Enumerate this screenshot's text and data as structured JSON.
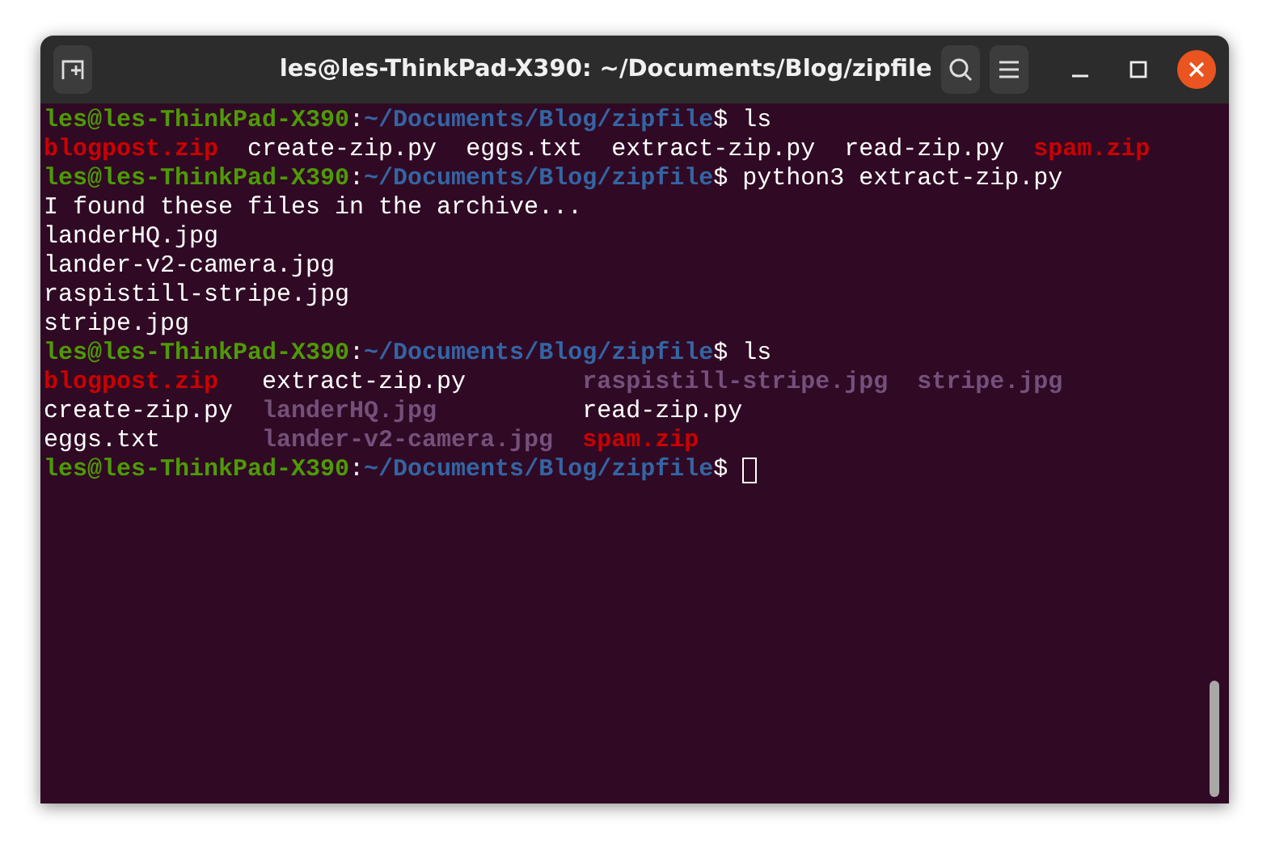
{
  "window": {
    "title": "les@les-ThinkPad-X390: ~/Documents/Blog/zipfile"
  },
  "terminal": {
    "lines": [
      {
        "kind": "prompt",
        "user": "les@les-ThinkPad-X390",
        "sep": ":",
        "path": "~/Documents/Blog/zipfile",
        "sign": "$",
        "command": "ls"
      },
      {
        "kind": "files",
        "rows": [
          [
            {
              "name": "blogpost.zip",
              "color": "#cc0000"
            },
            {
              "name": "create-zip.py",
              "color": "#ffffff"
            },
            {
              "name": "eggs.txt",
              "color": "#ffffff"
            },
            {
              "name": "extract-zip.py",
              "color": "#ffffff"
            },
            {
              "name": "read-zip.py",
              "color": "#ffffff"
            },
            {
              "name": "spam.zip",
              "color": "#cc0000"
            }
          ]
        ]
      },
      {
        "kind": "prompt",
        "user": "les@les-ThinkPad-X390",
        "sep": ":",
        "path": "~/Documents/Blog/zipfile",
        "sign": "$",
        "command": "python3 extract-zip.py"
      },
      {
        "kind": "output",
        "text": "I found these files in the archive..."
      },
      {
        "kind": "output",
        "text": "landerHQ.jpg"
      },
      {
        "kind": "output",
        "text": "lander-v2-camera.jpg"
      },
      {
        "kind": "output",
        "text": "raspistill-stripe.jpg"
      },
      {
        "kind": "output",
        "text": "stripe.jpg"
      },
      {
        "kind": "prompt",
        "user": "les@les-ThinkPad-X390",
        "sep": ":",
        "path": "~/Documents/Blog/zipfile",
        "sign": "$",
        "command": "ls"
      },
      {
        "kind": "files",
        "rows": [
          [
            {
              "name": "blogpost.zip",
              "color": "#cc0000"
            },
            {
              "name": "extract-zip.py",
              "color": "#ffffff"
            },
            {
              "name": "raspistill-stripe.jpg",
              "color": "#75507b"
            },
            {
              "name": "stripe.jpg",
              "color": "#75507b"
            }
          ],
          [
            {
              "name": "create-zip.py",
              "color": "#ffffff"
            },
            {
              "name": "landerHQ.jpg",
              "color": "#75507b"
            },
            {
              "name": "read-zip.py",
              "color": "#ffffff"
            }
          ],
          [
            {
              "name": "eggs.txt",
              "color": "#ffffff"
            },
            {
              "name": "lander-v2-camera.jpg",
              "color": "#75507b"
            },
            {
              "name": "spam.zip",
              "color": "#cc0000"
            }
          ]
        ]
      },
      {
        "kind": "prompt",
        "user": "les@les-ThinkPad-X390",
        "sep": ":",
        "path": "~/Documents/Blog/zipfile",
        "sign": "$",
        "cursor": true
      }
    ]
  }
}
